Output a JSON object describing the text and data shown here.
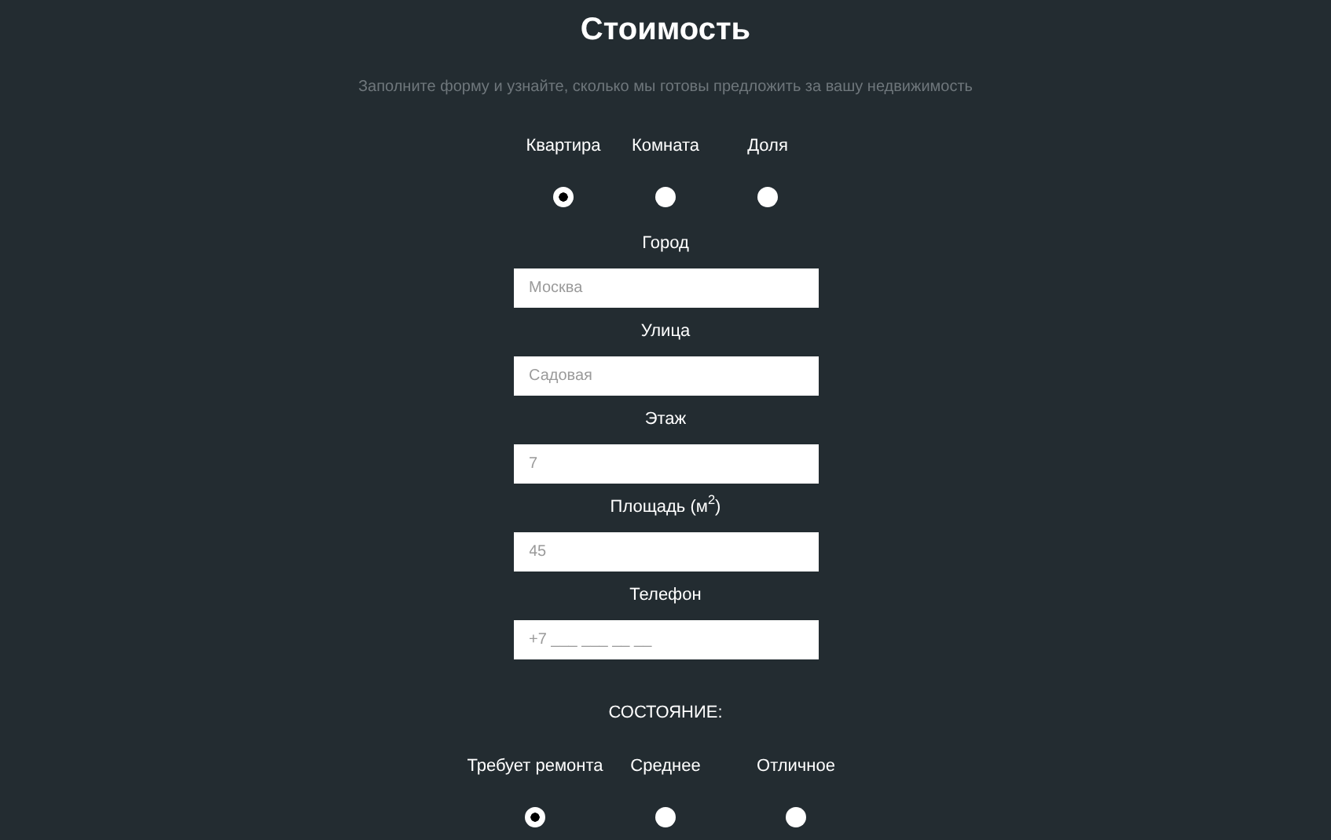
{
  "title": "Стоимость",
  "subtitle": "Заполните форму и узнайте, сколько мы готовы предложить за вашу недвижимость",
  "property_types": [
    {
      "label": "Квартира",
      "selected": true
    },
    {
      "label": "Комната",
      "selected": false
    },
    {
      "label": "Доля",
      "selected": false
    }
  ],
  "fields": [
    {
      "label": "Город",
      "placeholder": "Москва"
    },
    {
      "label": "Улица",
      "placeholder": "Садовая"
    },
    {
      "label": "Этаж",
      "placeholder": "7"
    },
    {
      "label": "Площадь (м$^{2}$)",
      "placeholder": "45"
    },
    {
      "label": "Телефон",
      "placeholder": "+7 ___ ___ __ __"
    }
  ],
  "condition_heading": "СОСТОЯНИЕ:",
  "conditions": [
    {
      "label": "Требует ремонта",
      "selected": true
    },
    {
      "label": "Среднее",
      "selected": false
    },
    {
      "label": "Отличное",
      "selected": false
    }
  ]
}
